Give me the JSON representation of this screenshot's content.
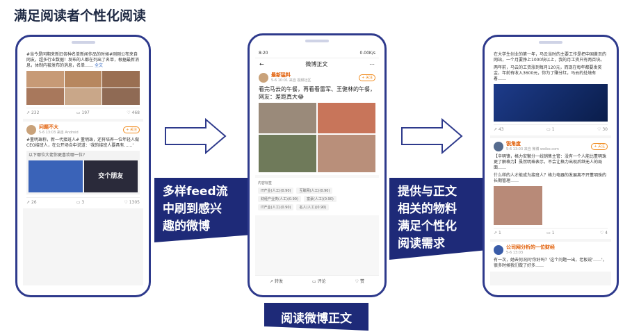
{
  "page_title": "满足阅读者个性化阅读",
  "label_left": [
    "多样feed流",
    "中刷到感兴",
    "趣的微博"
  ],
  "label_right": [
    "提供与正文",
    "相关的物料",
    "满足个性化",
    "阅读需求"
  ],
  "label_bottom": "阅读微博正文",
  "phone_left": {
    "post1": {
      "text": "#当今是同期来新旧各种名单新闻作品的时候#刚刚公布来自网友，超多行业数据！发布的人都在列出了名单，根据最新消息，体制内被发布的消息，名单……",
      "link": "全文",
      "actions": [
        "232",
        "197",
        "468"
      ]
    },
    "post2": {
      "user": "问题不大",
      "meta": "5-6 13:03 来自 Android",
      "follow": "+ 关注",
      "text": "#董明珠称，新一代接班人# 董明珠，还将培养一位年轻人做CEO接班人，在公开场合中说道：'我的接班人要具有……'",
      "question": "以下哪位大佬你更喜欢哪一位?",
      "video_caption": "交个朋友",
      "actions": [
        "26",
        "3",
        "1305"
      ]
    }
  },
  "phone_mid": {
    "status_time": "8:20",
    "status_right": "0.00K/s",
    "nav_title": "微博正文",
    "user": "最新猛料",
    "meta": "5-6 10:01 来自 视频社区",
    "follow": "+ 关注",
    "text": "看完马云的午餐，再看看雷军、王健林的午餐，网友：差距真大😂",
    "tags_title": "内容标签",
    "tags": [
      [
        "IT产业(人工)(0.90)",
        "互联网(人工)(0.90)"
      ],
      [
        "财经产业类(人工)(0.90)",
        "富豪(人工)(0.90)"
      ],
      [
        "IT产业(人工)(0.90)",
        "名人(人工)(0.90)"
      ]
    ],
    "bottom": [
      "转发",
      "评论",
      "赞"
    ]
  },
  "phone_right": {
    "post1": {
      "text": "在大学生创业的第一年，马云当时的主要工作是把中国黄页的网站，一个月要挣上1000块以上，我的月工资只有两百块。",
      "text2": "两年前，马云的工资涨到每月120元，而现在每年都要发奖金，年前有收入3600元，你为了赚分红，马云的处境有着……",
      "actions": [
        "43",
        "1",
        "30"
      ]
    },
    "post2": {
      "user": "锐角度",
      "meta": "5-6 13:03 来自 微博 weibo.com",
      "follow": "+ 关注",
      "text": "【辛明锋，格力安徽分一线销售主管：没有一个人能比董明珠更了解格力】虽然明珠表示，不会让格力出现后继无人的局面……",
      "text2": "什么样的人才能成为接班人？格力电器的发展离不开董明珠的长期管理……",
      "actions": [
        "1",
        "1",
        "4"
      ]
    },
    "post3": {
      "user": "公司网分析的一位财经",
      "meta": "5-6 13:03",
      "text": "有一次，她去何况问'你好吗？'这个问题一出，老板说'……'，很多时候我们做了好多……"
    }
  }
}
